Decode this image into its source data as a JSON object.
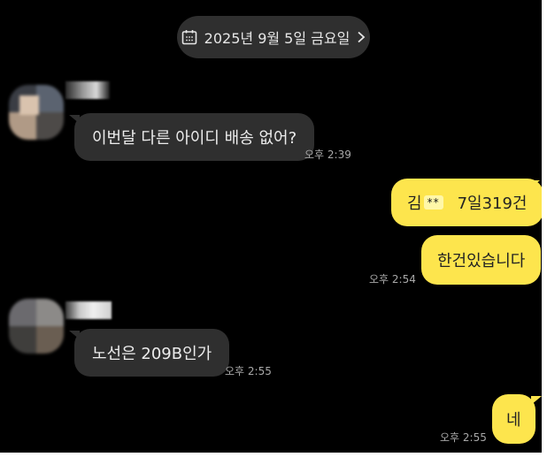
{
  "date_divider": {
    "date": "2025년 9월 5일 금요일",
    "chevron": "›"
  },
  "messages": [
    {
      "side": "in",
      "text": "이번달 다른 아이디 배송 없어?",
      "time": "오후 2:39"
    },
    {
      "side": "out",
      "name": "김",
      "masked": "**",
      "text": "7일319건",
      "time": ""
    },
    {
      "side": "out",
      "text": "한건있습니다",
      "time": "오후 2:54"
    },
    {
      "side": "in",
      "text": "노선은 209B인가",
      "time": "오후 2:55"
    },
    {
      "side": "out",
      "text": "네",
      "time": "오후 2:55"
    }
  ],
  "colors": {
    "background": "#000000",
    "incoming_bubble": "#2f2f2f",
    "outgoing_bubble": "#fde54d",
    "timestamp": "#a8a8a8"
  },
  "icons": {
    "calendar": "calendar-icon",
    "chevron": "chevron-right-icon"
  }
}
